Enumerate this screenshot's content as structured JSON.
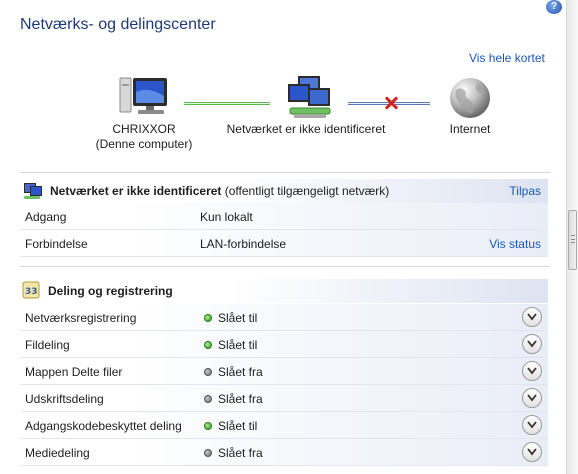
{
  "title": "Netværks- og delingscenter",
  "help_symbol": "?",
  "view_full_map": "Vis hele kortet",
  "diagram": {
    "computer_name": "CHRIXXOR",
    "computer_sub": "(Denne computer)",
    "network_label": "Netværket er ikke identificeret",
    "internet_label": "Internet"
  },
  "network_section": {
    "name": "Netværket er ikke identificeret",
    "type": "(offentligt tilgængeligt netværk)",
    "customize_link": "Tilpas",
    "rows": [
      {
        "label": "Adgang",
        "value": "Kun lokalt"
      },
      {
        "label": "Forbindelse",
        "value": "LAN-forbindelse",
        "link": "Vis status"
      }
    ]
  },
  "sharing_section": {
    "title": "Deling og registrering",
    "items": [
      {
        "label": "Netværksregistrering",
        "status": "Slået til",
        "on": true
      },
      {
        "label": "Fildeling",
        "status": "Slået til",
        "on": true
      },
      {
        "label": "Mappen Delte filer",
        "status": "Slået fra",
        "on": false
      },
      {
        "label": "Udskriftsdeling",
        "status": "Slået fra",
        "on": false
      },
      {
        "label": "Adgangskodebeskyttet deling",
        "status": "Slået til",
        "on": true
      },
      {
        "label": "Mediedeling",
        "status": "Slået fra",
        "on": false
      }
    ]
  },
  "colors": {
    "title": "#1e3a78",
    "link": "#1c57b8",
    "status_on": "#2c9a1c",
    "status_off": "#6a6a6a",
    "disconnect": "#d4231e"
  }
}
